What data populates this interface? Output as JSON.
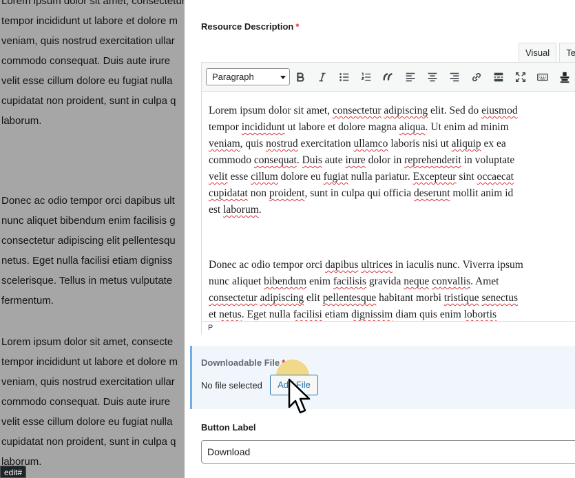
{
  "background": {
    "paragraph_1": [
      "Lorem ipsum dolor sit amet, consectetur adipiscing",
      "tempor incididunt ut labore et dolore m",
      "veniam, quis nostrud exercitation ullar",
      "commodo consequat. Duis aute irure",
      "velit esse cillum dolore eu fugiat nulla",
      "cupidatat non proident, sunt in culpa q",
      "laborum."
    ],
    "paragraph_2": [
      "Donec ac odio tempor orci dapibus ult",
      "nunc aliquet bibendum enim facilisis g",
      "consectetur adipiscing elit pellentesqu",
      "netus. Eget nulla facilisi etiam digniss",
      "scelerisque. Tellus in metus vulputate",
      "fermentum."
    ],
    "paragraph_3": [
      "Lorem ipsum dolor sit amet, consecte",
      "tempor incididunt ut labore et dolore m",
      "veniam, quis nostrud exercitation ullar",
      "commodo consequat. Duis aute irure",
      "velit esse cillum dolore eu fugiat nulla",
      "cupidatat non proident, sunt in culpa q",
      "laborum."
    ],
    "status_tag": "edit#"
  },
  "panel": {
    "description_label": "Resource Description",
    "required_mark": "*",
    "tabs": {
      "visual": "Visual",
      "text": "Te"
    },
    "toolbar": {
      "format_value": "Paragraph"
    },
    "path": "P",
    "downloadable_label": "Downloadable File",
    "no_file_text": "No file selected",
    "add_file_label": "Add File",
    "button_label_label": "Button Label",
    "button_label_value": "Download"
  },
  "colors": {
    "accent": "#2271b1",
    "required": "#d63638",
    "highlight": "#f0c83c"
  },
  "icons": [
    "bold-icon",
    "italic-icon",
    "bullet-list-icon",
    "numbered-list-icon",
    "blockquote-icon",
    "align-left-icon",
    "align-center-icon",
    "align-right-icon",
    "link-icon",
    "read-more-icon",
    "fullscreen-icon",
    "keyboard-icon",
    "toolbar-toggle-icon",
    "cursor-icon"
  ]
}
